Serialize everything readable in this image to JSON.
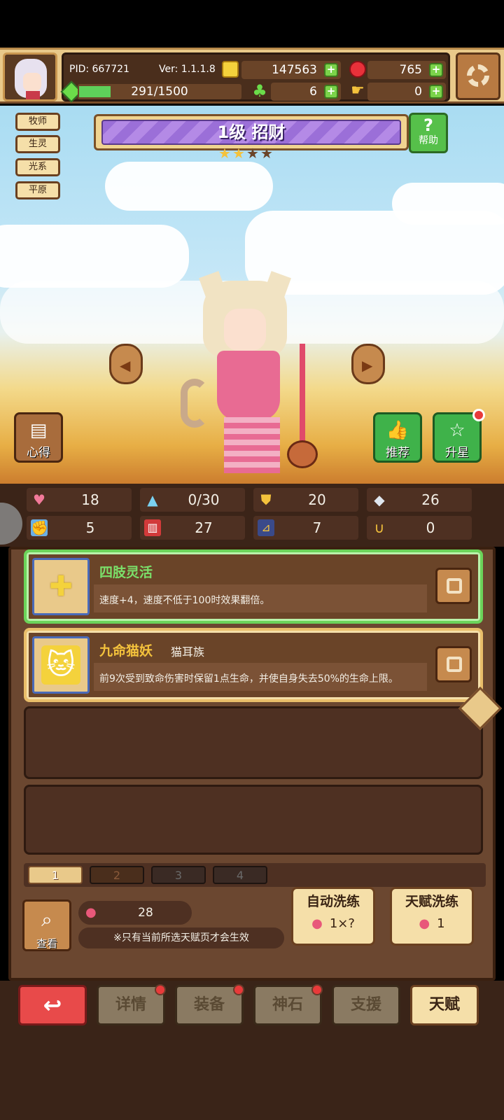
{
  "header": {
    "pid": "PID: 667721",
    "version": "Ver: 1.1.1.8",
    "coins": "147563",
    "rubies": "765",
    "stamina": "291/1500",
    "stamina_progress": 0.194,
    "clovers": "6",
    "hands": "0"
  },
  "tags": [
    "牧师",
    "生灵",
    "光系",
    "平原"
  ],
  "hero": {
    "title": "1级  招财",
    "stars_filled": 2,
    "stars_total": 4,
    "help_label": "帮助",
    "xinde_label": "心得",
    "recommend_label": "推荐",
    "star_up_label": "升星"
  },
  "stats": {
    "hp": "18",
    "mana": "0/30",
    "defense": "20",
    "attack2": "26",
    "strength": "5",
    "intel": "27",
    "speed": "7",
    "luck": "0"
  },
  "talents": [
    {
      "name": "四肢灵活",
      "sub": "",
      "desc": "速度+4，速度不低于100时效果翻倍。",
      "state": "active",
      "icon": "plus-icon"
    },
    {
      "name": "九命猫妖",
      "sub": "猫耳族",
      "desc": "前9次受到致命伤害时保留1点生命，并使自身失去50%的生命上限。",
      "state": "normal",
      "icon": "cat-icon"
    }
  ],
  "page_tabs": [
    "1",
    "2",
    "3",
    "4"
  ],
  "bottom_panel": {
    "view_label": "查看",
    "peach_count": "28",
    "note": "※只有当前所选天赋页才会生效",
    "auto_wash_label": "自动洗练",
    "auto_wash_cost": "1×?",
    "talent_wash_label": "天赋洗练",
    "talent_wash_cost": "1"
  },
  "nav": {
    "details": "详情",
    "equipment": "装备",
    "godstone": "神石",
    "support": "支援",
    "talent": "天赋"
  },
  "colors": {
    "accent_green": "#6bd45a",
    "gold_border": "#e9be6a",
    "panel_brown": "#6b4730",
    "ruby_red": "#e8313a"
  }
}
